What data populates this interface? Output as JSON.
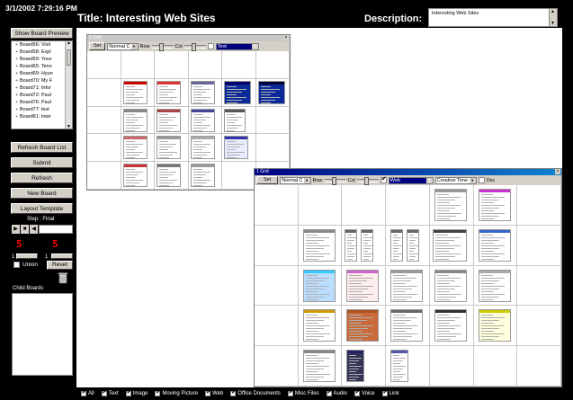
{
  "header": {
    "timestamp": "3/1/2002 7:29:16 PM",
    "title": "Title: Interesting Web Sites",
    "description_label": "Description:",
    "description_value": "Interesting Web Sites"
  },
  "sidebar": {
    "show_board_preview": "Show Board Preview",
    "boards": [
      "Board56: Visit",
      "Board58: Expl",
      "Board59: Yosv",
      "Board65: Tenn",
      "Board69: Hyun",
      "Board70: My F",
      "Board71: Infor",
      "Board72: Paul",
      "Board76: Paul",
      "Board77: test",
      "Board81: Inter"
    ],
    "refresh_board_list": "Refresh Board List",
    "submit": "Submit",
    "refresh": "Refresh",
    "new_board": "New Board",
    "layout_template": "Layout Template",
    "step_label": "Step : Final",
    "player_buttons": [
      "▶",
      "■",
      "◀"
    ],
    "row_value": "5",
    "col_value": "5",
    "row_small": "1",
    "col_small": "1",
    "union_label": "Union",
    "reset": "Reset",
    "child_boards_label": "Child Boards"
  },
  "window2": {
    "title": "2 Grid",
    "set": "Set",
    "mode": "Normal C",
    "row_label": "Row",
    "col_label": "Col",
    "filter_value": "Text"
  },
  "window1": {
    "title": "1 Grid",
    "set": "Set",
    "mode": "Normal C",
    "row_label": "Row",
    "col_label": "Col",
    "filter_value": "Web",
    "sort_value": "Creation Time",
    "desc_label": "Dsc"
  },
  "filters": [
    {
      "label": "All",
      "checked": true
    },
    {
      "label": "Text",
      "checked": true
    },
    {
      "label": "Image",
      "checked": true
    },
    {
      "label": "Moving Picture",
      "checked": true
    },
    {
      "label": "Web",
      "checked": true
    },
    {
      "label": "Office Documents",
      "checked": true
    },
    {
      "label": "Misc Files",
      "checked": true
    },
    {
      "label": "Audio",
      "checked": true
    },
    {
      "label": "Voice",
      "checked": true
    },
    {
      "label": "Link",
      "checked": true
    }
  ],
  "colors": {
    "background": "#000000",
    "accent_red": "#ff0000",
    "titlebar_active": "#000080",
    "chrome": "#d4d0c8"
  }
}
